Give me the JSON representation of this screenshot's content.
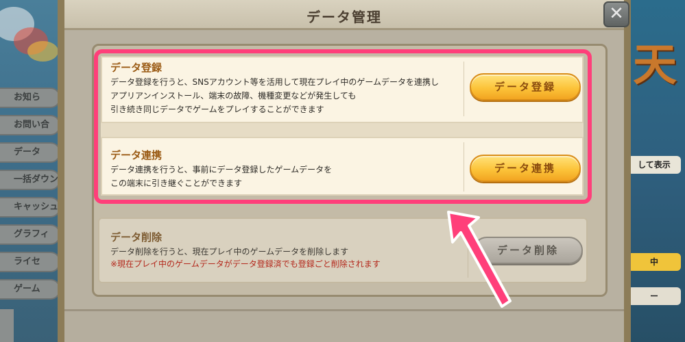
{
  "dialog": {
    "title": "データ管理",
    "close_label": "✕"
  },
  "sections": [
    {
      "title": "データ登録",
      "description": "データ登録を行うと、SNSアカウント等を活用して現在プレイ中のゲームデータを連携し\nアプリアンインストール、端末の故障、機種変更などが発生しても\n引き続き同じデータでゲームをプレイすることができます",
      "button_label": "データ登録"
    },
    {
      "title": "データ連携",
      "description": "データ連携を行うと、事前にデータ登録したゲームデータを\nこの端末に引き継ぐことができます",
      "button_label": "データ連携"
    },
    {
      "title": "データ削除",
      "description": "データ削除を行うと、現在プレイ中のゲームデータを削除します",
      "warning": "※現在プレイ中のゲームデータがデータ登録済でも登録ごと削除されます",
      "button_label": "データ削除"
    }
  ],
  "background": {
    "left_menu": [
      "お知ら",
      "お問い合",
      "データ",
      "一括ダウン",
      "キャッシュ",
      "グラフィ",
      "ライセ",
      "ゲーム"
    ],
    "right_kanji": "天",
    "right_tags": [
      "して表示",
      "中",
      "ー"
    ]
  },
  "colors": {
    "highlight": "#ff3f7a",
    "title_brown": "#9a5a14",
    "warning_red": "#b3261a",
    "gold_button": "#fcc43a"
  },
  "icons": {
    "close": "close-icon",
    "pointer": "arrow-pointer-icon"
  }
}
